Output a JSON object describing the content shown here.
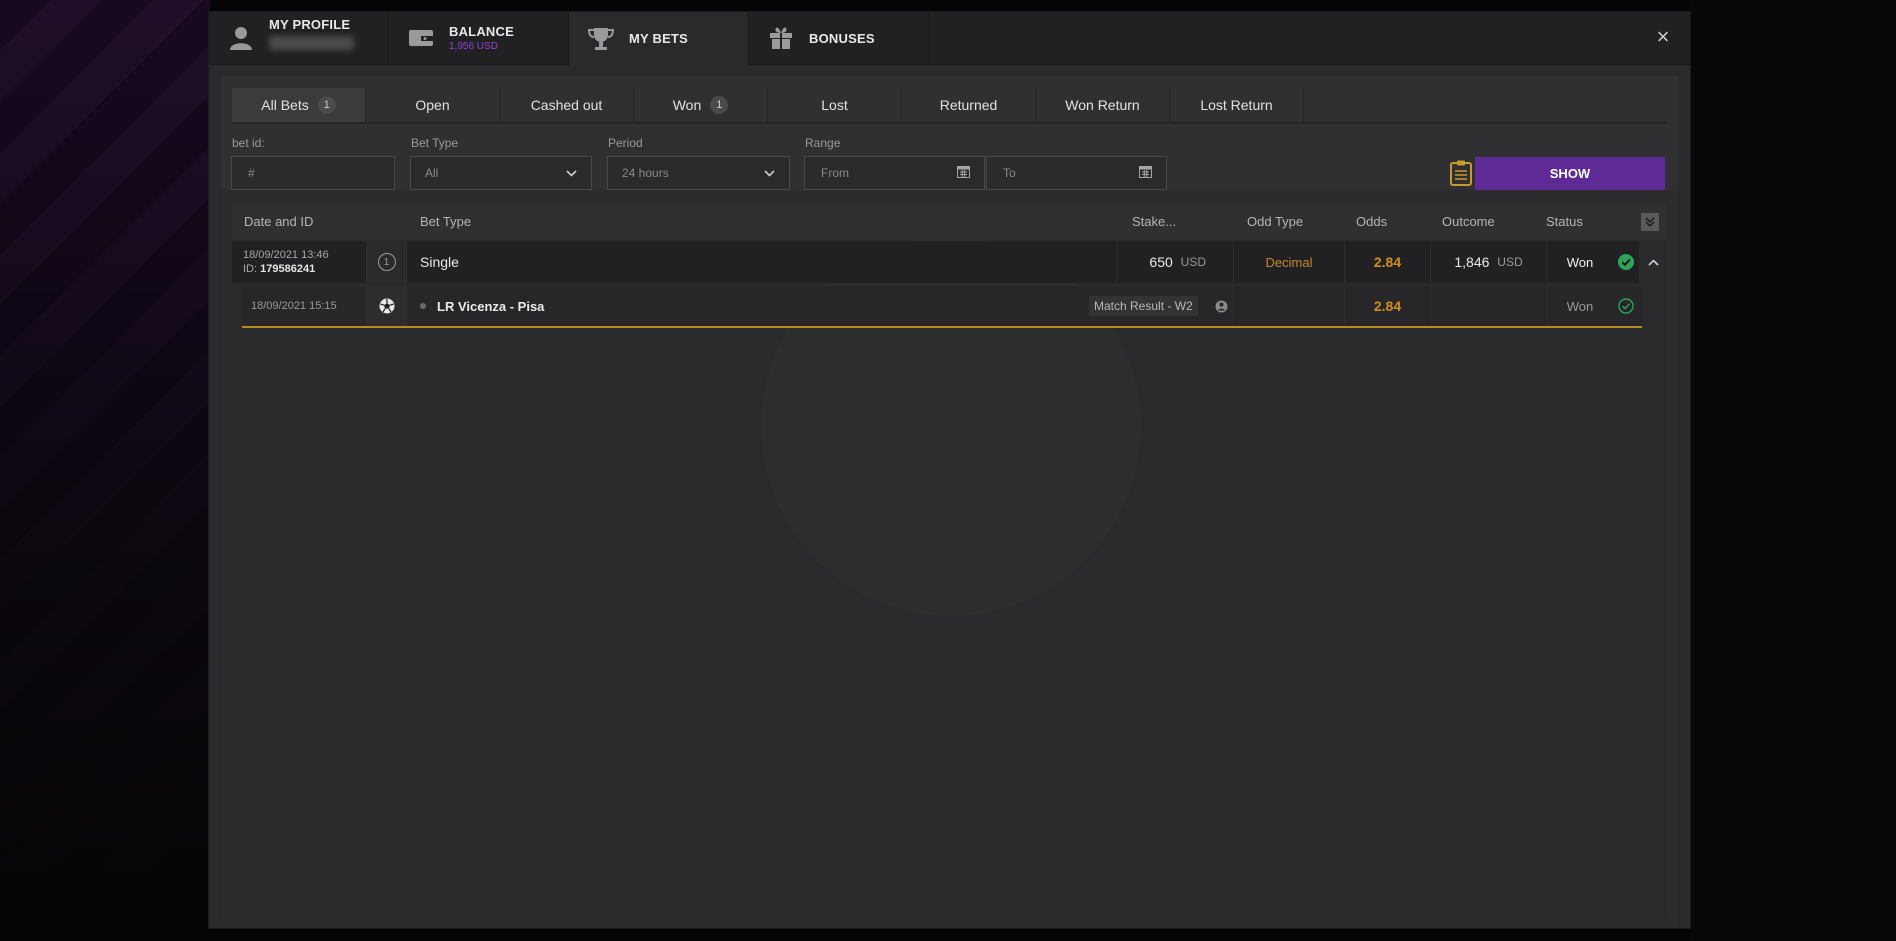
{
  "profile_tabs": [
    {
      "label": "MY PROFILE",
      "icon": "user-icon"
    },
    {
      "label": "BALANCE",
      "sub": "1,956 USD",
      "icon": "wallet-icon"
    },
    {
      "label": "MY BETS",
      "icon": "trophy-icon",
      "active": true
    },
    {
      "label": "BONUSES",
      "icon": "gift-icon"
    }
  ],
  "close_glyph": "×",
  "status_tabs": [
    {
      "label": "All Bets",
      "count": "1",
      "active": true
    },
    {
      "label": "Open"
    },
    {
      "label": "Cashed out"
    },
    {
      "label": "Won",
      "count": "1"
    },
    {
      "label": "Lost"
    },
    {
      "label": "Returned"
    },
    {
      "label": "Won Return"
    },
    {
      "label": "Lost Return"
    }
  ],
  "filters": {
    "bet_id_label": "bet id:",
    "bet_id_placeholder": "#",
    "bet_type_label": "Bet Type",
    "bet_type_value": "All",
    "period_label": "Period",
    "period_value": "24 hours",
    "range_label": "Range",
    "from_placeholder": "From",
    "to_placeholder": "To",
    "show_label": "SHOW"
  },
  "table": {
    "headers": {
      "date_id": "Date and ID",
      "bet_type": "Bet Type",
      "stake": "Stake...",
      "odd_type": "Odd Type",
      "odds": "Odds",
      "outcome": "Outcome",
      "status": "Status"
    },
    "bet": {
      "date": "18/09/2021 13:46",
      "id_prefix": "ID:",
      "id": "179586241",
      "type_num": "1",
      "type": "Single",
      "stake": "650",
      "stake_currency": "USD",
      "odd_type": "Decimal",
      "odds": "2.84",
      "outcome": "1,846",
      "outcome_currency": "USD",
      "status": "Won"
    },
    "event": {
      "date": "18/09/2021 15:15",
      "name": "LR Vicenza - Pisa",
      "market": "Match Result - W2",
      "odds": "2.84",
      "status": "Won"
    }
  },
  "colors": {
    "accent_purple": "#5e2a96",
    "gold": "#d18e1e",
    "won_green": "#2ea35a"
  }
}
